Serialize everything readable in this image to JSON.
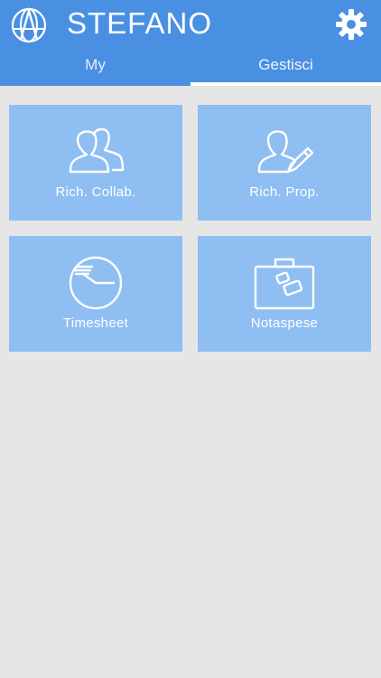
{
  "header": {
    "user_name": "STEFANO",
    "logo_icon": "globe-a-logo-icon",
    "settings_icon": "gear-icon",
    "color": "#4a90e2"
  },
  "tabs": [
    {
      "label": "My",
      "active": false
    },
    {
      "label": "Gestisci",
      "active": true
    }
  ],
  "tiles": [
    {
      "label": "Rich. Collab.",
      "icon": "users-icon"
    },
    {
      "label": "Rich. Prop.",
      "icon": "user-edit-icon"
    },
    {
      "label": "Timesheet",
      "icon": "clock-icon"
    },
    {
      "label": "Notaspese",
      "icon": "briefcase-icon"
    }
  ],
  "tile_color": "#8fbef2",
  "background_color": "#e6e6e6"
}
